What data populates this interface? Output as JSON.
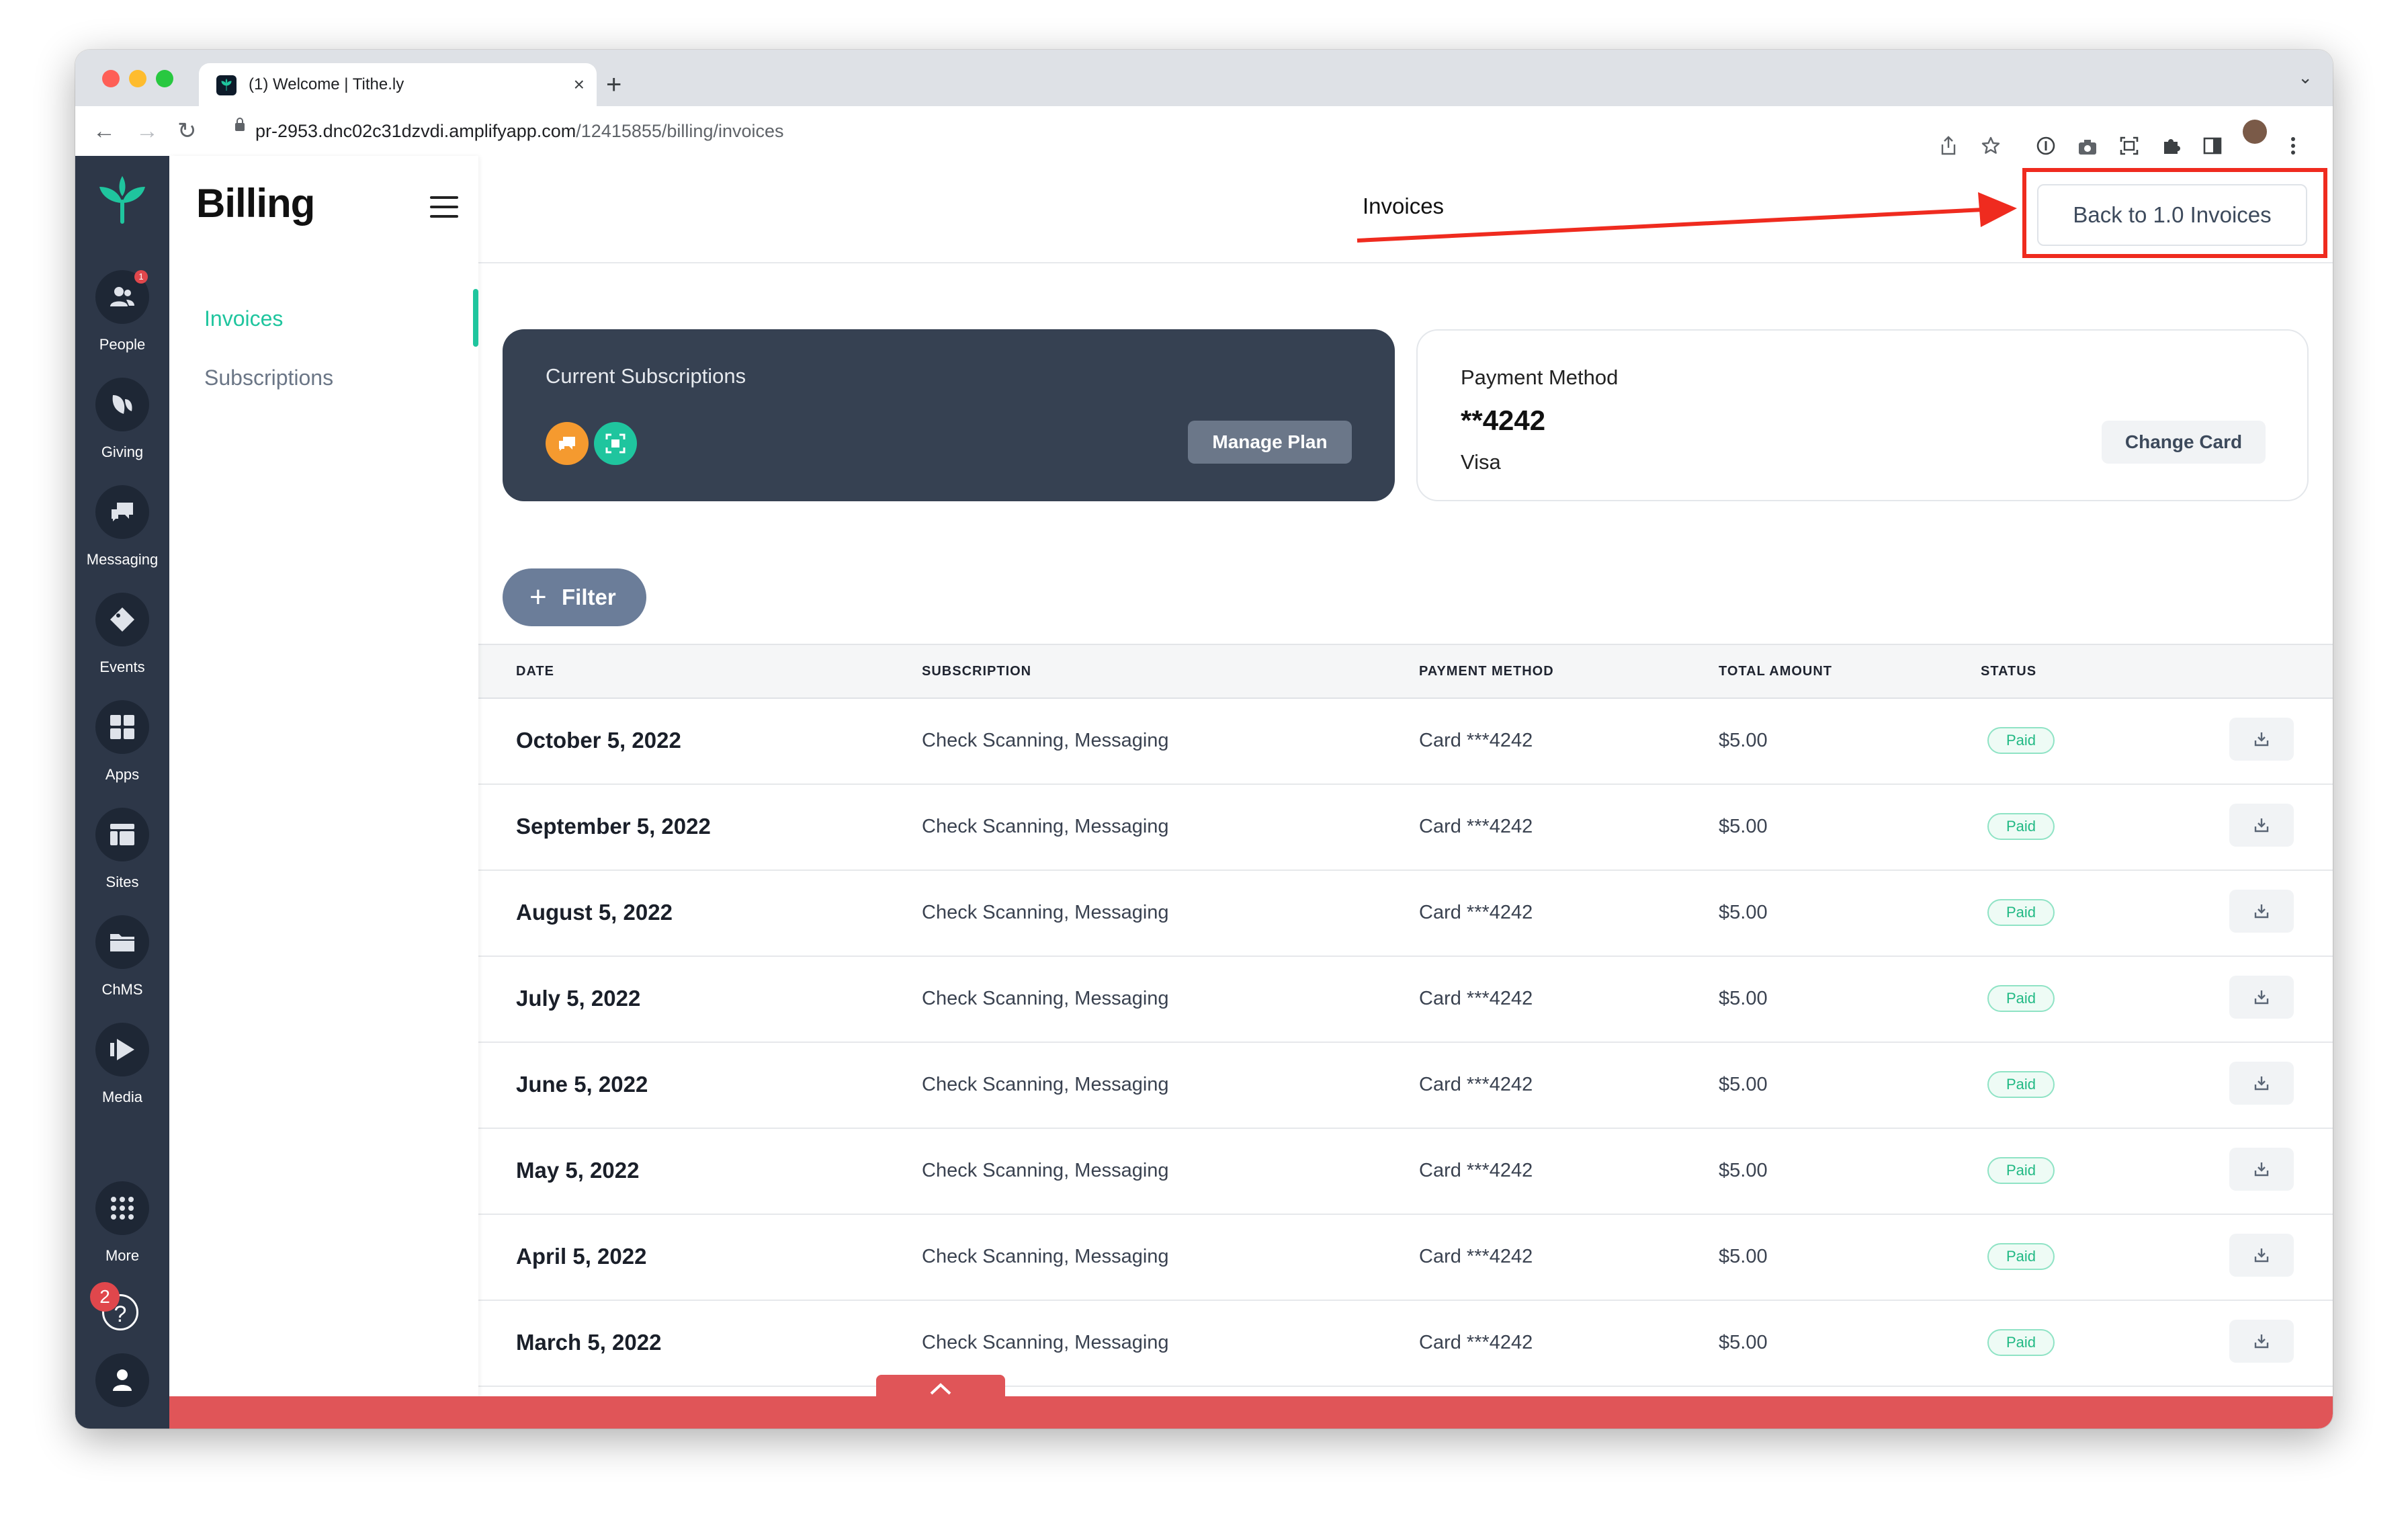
{
  "browser": {
    "tab_title": "(1) Welcome | Tithe.ly",
    "tab_close": "×",
    "new_tab": "+",
    "tabs_dropdown": "⌄",
    "url_host": "pr-2953.dnc02c31dzvdi.amplifyapp.com",
    "url_path": "/12415855/billing/invoices",
    "back_glyph": "←",
    "forward_glyph": "→",
    "reload_glyph": "↻",
    "icons": [
      "share-icon",
      "star-icon",
      "info-icon",
      "camera-icon",
      "screenshot-icon",
      "puzzle-icon",
      "sidebar-icon",
      "profile-avatar",
      "more-icon"
    ]
  },
  "rail": {
    "items": [
      {
        "label": "People",
        "badge": "1"
      },
      {
        "label": "Giving"
      },
      {
        "label": "Messaging"
      },
      {
        "label": "Events"
      },
      {
        "label": "Apps"
      },
      {
        "label": "Sites"
      },
      {
        "label": "ChMS"
      },
      {
        "label": "Media"
      },
      {
        "label": "More"
      }
    ],
    "help_badge": "2",
    "help_glyph": "?"
  },
  "subnav": {
    "title": "Billing",
    "links": [
      {
        "label": "Invoices",
        "active": true
      },
      {
        "label": "Subscriptions",
        "active": false
      }
    ]
  },
  "header": {
    "title": "Invoices",
    "back_button": "Back to 1.0 Invoices",
    "annotation_color": "#ef2b1f"
  },
  "subscriptions_card": {
    "title": "Current Subscriptions",
    "icons": [
      {
        "name": "messaging-icon",
        "color": "#f59a2f"
      },
      {
        "name": "scanner-icon",
        "color": "#1fc59e"
      }
    ],
    "button": "Manage Plan"
  },
  "payment_card": {
    "label": "Payment Method",
    "number": "**4242",
    "brand": "Visa",
    "button": "Change Card"
  },
  "filter": {
    "plus": "+",
    "label": "Filter"
  },
  "table": {
    "headers": [
      "DATE",
      "SUBSCRIPTION",
      "PAYMENT METHOD",
      "TOTAL AMOUNT",
      "STATUS"
    ],
    "rows": [
      {
        "date": "October 5, 2022",
        "subscription": "Check Scanning, Messaging",
        "method": "Card ***4242",
        "amount": "$5.00",
        "status": "Paid"
      },
      {
        "date": "September 5, 2022",
        "subscription": "Check Scanning, Messaging",
        "method": "Card ***4242",
        "amount": "$5.00",
        "status": "Paid"
      },
      {
        "date": "August 5, 2022",
        "subscription": "Check Scanning, Messaging",
        "method": "Card ***4242",
        "amount": "$5.00",
        "status": "Paid"
      },
      {
        "date": "July 5, 2022",
        "subscription": "Check Scanning, Messaging",
        "method": "Card ***4242",
        "amount": "$5.00",
        "status": "Paid"
      },
      {
        "date": "June 5, 2022",
        "subscription": "Check Scanning, Messaging",
        "method": "Card ***4242",
        "amount": "$5.00",
        "status": "Paid"
      },
      {
        "date": "May 5, 2022",
        "subscription": "Check Scanning, Messaging",
        "method": "Card ***4242",
        "amount": "$5.00",
        "status": "Paid"
      },
      {
        "date": "April 5, 2022",
        "subscription": "Check Scanning, Messaging",
        "method": "Card ***4242",
        "amount": "$5.00",
        "status": "Paid"
      },
      {
        "date": "March 5, 2022",
        "subscription": "Check Scanning, Messaging",
        "method": "Card ***4242",
        "amount": "$5.00",
        "status": "Paid"
      }
    ]
  },
  "colors": {
    "accent": "#1fc59e",
    "rail": "#2d3748",
    "card_dark": "#364152",
    "bottom_bar": "#e05558",
    "paid_text": "#21b984"
  }
}
